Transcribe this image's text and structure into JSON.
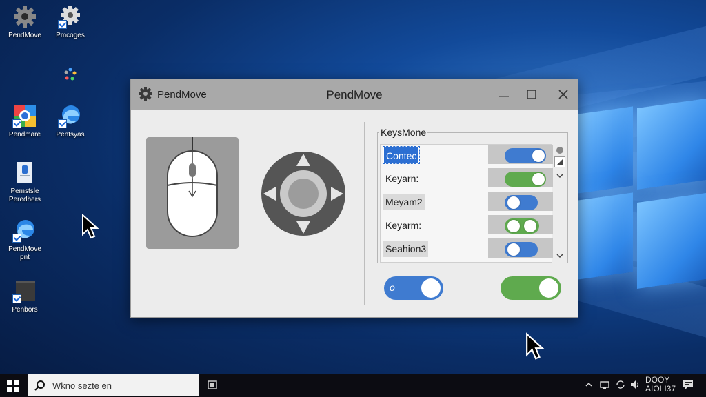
{
  "desktop": {
    "icons": [
      {
        "label": "PendMove"
      },
      {
        "label": "Pmcoges"
      },
      {
        "label": "Pendmare"
      },
      {
        "label": "Pentsyas"
      },
      {
        "label": "Pemstsle\nPeredhers"
      },
      {
        "label": "PendMove\npnt"
      },
      {
        "label": "Penbors"
      }
    ]
  },
  "window": {
    "app_name": "PendMove",
    "title": "PendMove",
    "group": {
      "label": "KeysMone",
      "rows": [
        {
          "label": "Contec"
        },
        {
          "label": "Keyarn:"
        },
        {
          "label": "Meyam2"
        },
        {
          "label": "Keyarm:"
        },
        {
          "label": "Seahion3"
        }
      ]
    },
    "bottom_toggle_left_label": "o"
  },
  "taskbar": {
    "search_placeholder": "Wkno sezte en",
    "clock_line1": "DOOY",
    "clock_line2": "AIOLI37"
  },
  "colors": {
    "toggle_blue": "#3f7bd0",
    "toggle_green": "#5faa4e",
    "selection": "#2c6fd2"
  }
}
